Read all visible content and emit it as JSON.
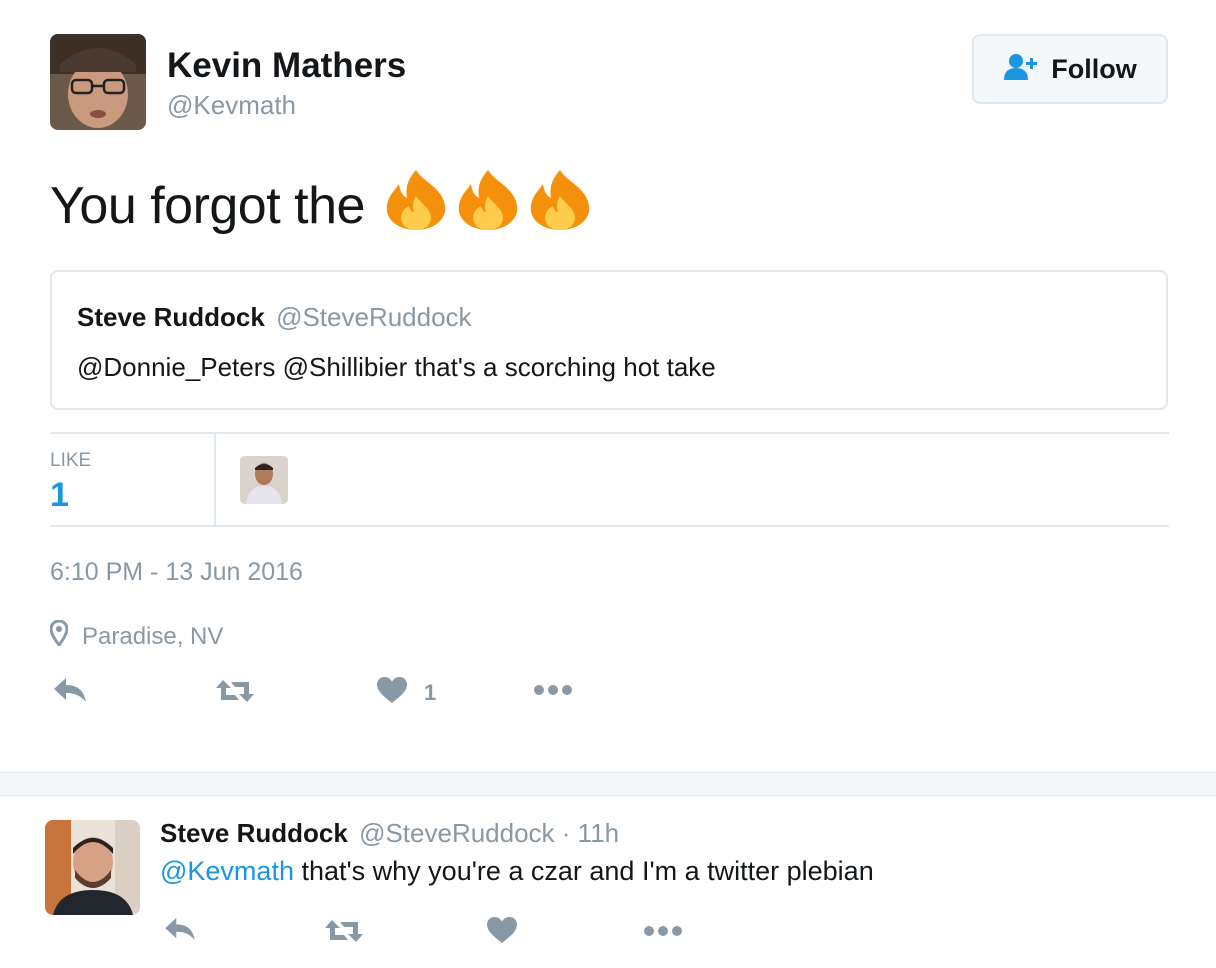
{
  "tweet": {
    "author": {
      "name": "Kevin Mathers",
      "handle": "@Kevmath"
    },
    "follow_label": "Follow",
    "text": "You forgot the",
    "emoji": [
      "fire-emoji",
      "fire-emoji",
      "fire-emoji"
    ],
    "quoted": {
      "name": "Steve Ruddock",
      "handle": "@SteveRuddock",
      "text": "@Donnie_Peters @Shillibier that's a scorching hot take"
    },
    "stats": {
      "like_label": "LIKE",
      "like_count": "1"
    },
    "timestamp": "6:10 PM - 13 Jun 2016",
    "location": "Paradise, NV",
    "actions": {
      "like_count": "1"
    }
  },
  "reply": {
    "name": "Steve Ruddock",
    "meta": "@SteveRuddock · 11h",
    "mention": "@Kevmath",
    "text": " that's why you're a czar and I'm a twitter plebian"
  },
  "colors": {
    "link": "#1b95e0",
    "muted": "#8899a6",
    "border": "#e1e8ed",
    "text": "#14171a",
    "fire": "#f4900c"
  },
  "icons": [
    "reply-icon",
    "retweet-icon",
    "heart-icon",
    "more-icon",
    "location-pin-icon",
    "follow-user-icon"
  ]
}
